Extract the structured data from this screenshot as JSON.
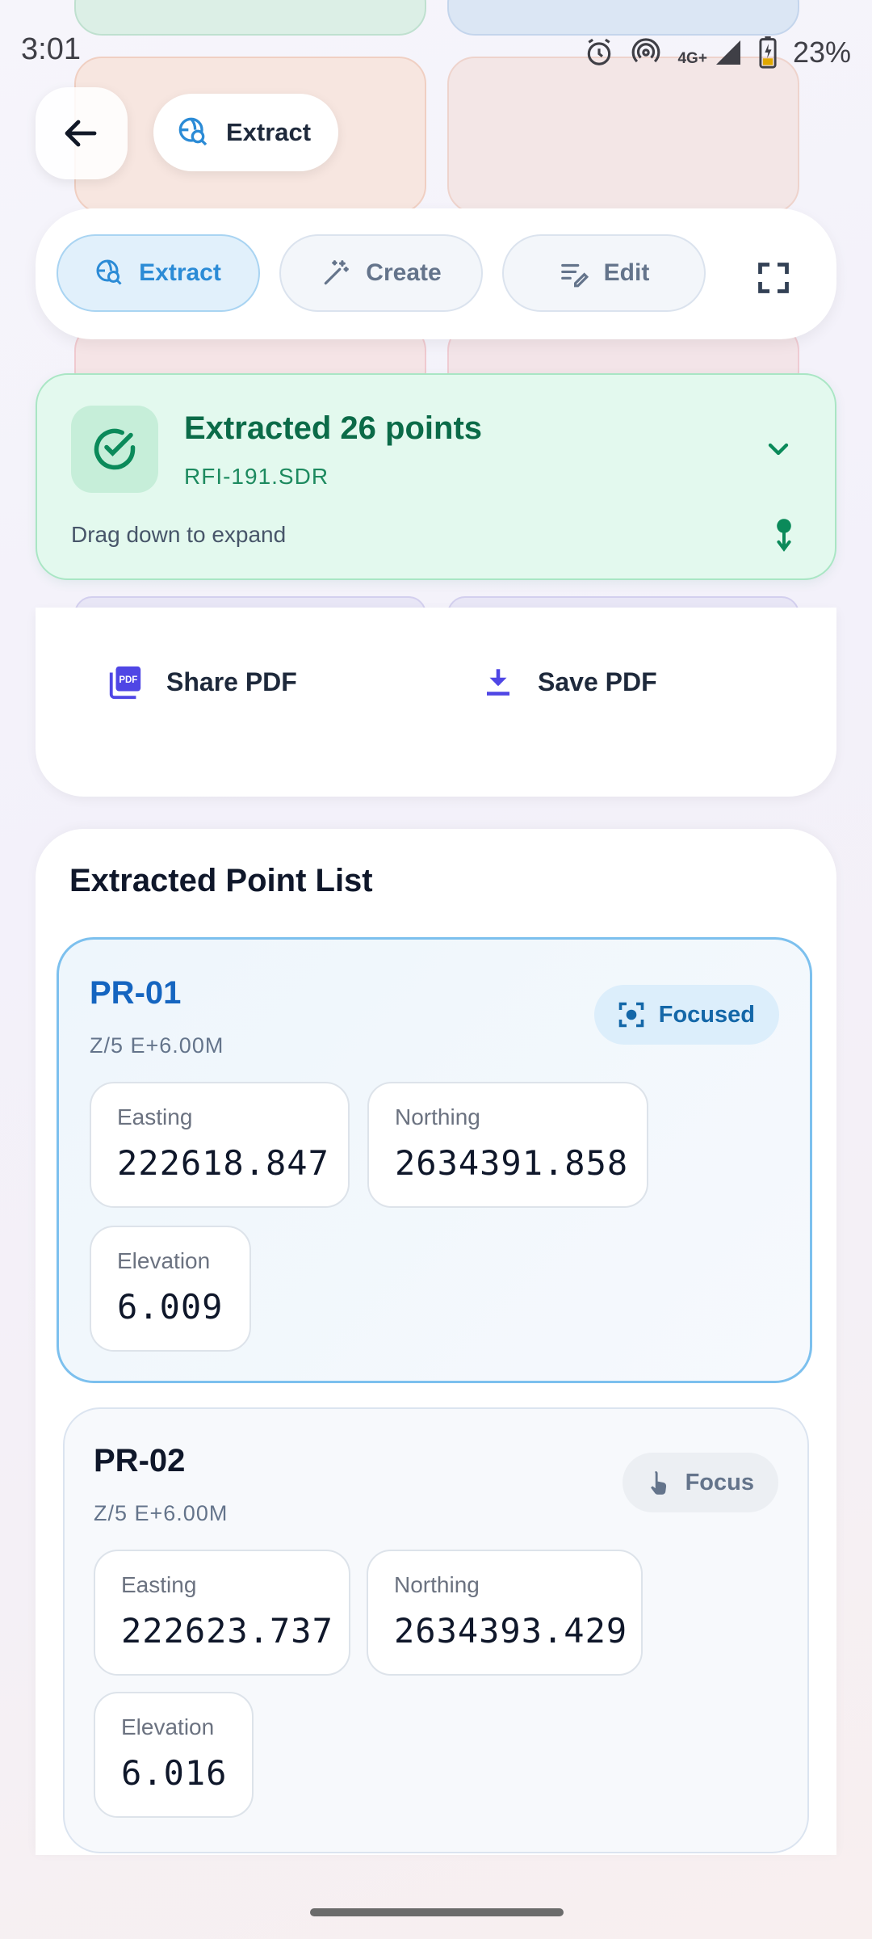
{
  "status_bar": {
    "time": "3:01",
    "network": "4G+",
    "battery": "23%",
    "icons": [
      "alarm-icon",
      "hotspot-icon",
      "signal-icon",
      "battery-charging-icon"
    ]
  },
  "header": {
    "back_icon": "arrow-left-icon",
    "title": "Extract",
    "title_icon": "globe-search-icon"
  },
  "modes": {
    "tabs": [
      {
        "label": "Extract",
        "icon": "globe-search-icon",
        "active": true
      },
      {
        "label": "Create",
        "icon": "magic-wand-icon",
        "active": false
      },
      {
        "label": "Edit",
        "icon": "edit-lines-icon",
        "active": false
      }
    ],
    "fullscreen_icon": "fullscreen-icon"
  },
  "banner": {
    "title": "Extracted 26 points",
    "file": "RFI-191.SDR",
    "hint": "Drag down to expand",
    "colors": {
      "bg": "#e3f9ee",
      "accent": "#0b6b48"
    }
  },
  "actions": {
    "share_label": "Share PDF",
    "save_label": "Save PDF",
    "accent": "#4f46e5"
  },
  "point_list": {
    "title": "Extracted Point List",
    "labels": {
      "easting": "Easting",
      "northing": "Northing",
      "elevation": "Elevation"
    },
    "points": [
      {
        "name": "PR-01",
        "sub": "Z/5 E+6.00M",
        "status": "Focused",
        "easting": "222618.847",
        "northing": "2634391.858",
        "elevation": "6.009"
      },
      {
        "name": "PR-02",
        "sub": "Z/5 E+6.00M",
        "status": "Focus",
        "easting": "222623.737",
        "northing": "2634393.429",
        "elevation": "6.016"
      }
    ]
  }
}
